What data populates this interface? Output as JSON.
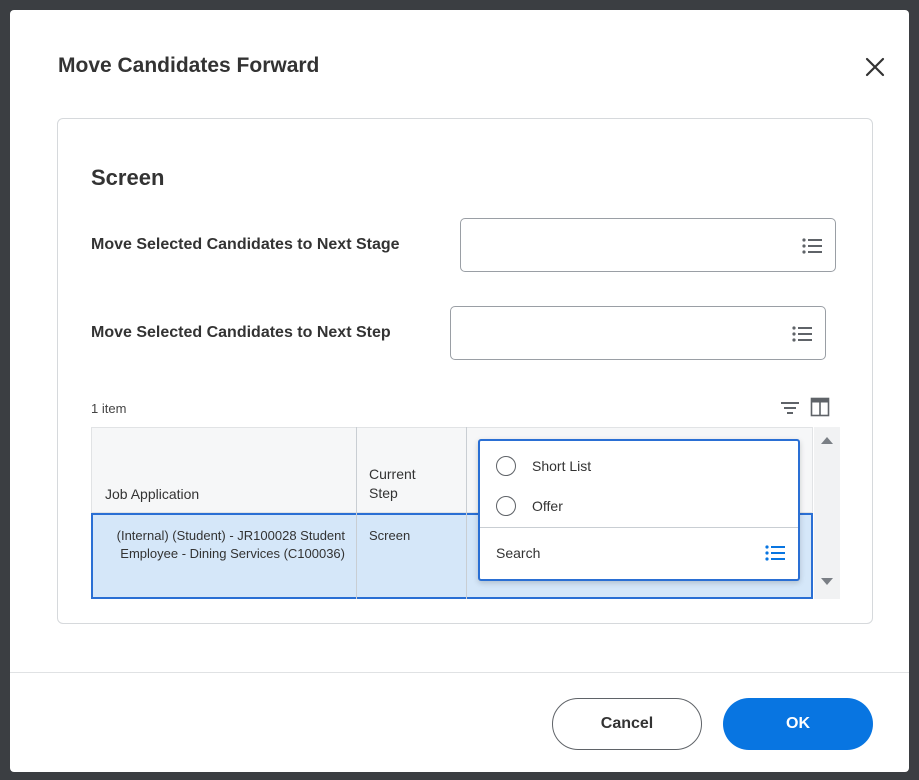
{
  "dialog": {
    "title": "Move Candidates Forward",
    "close_icon": "close-icon"
  },
  "section": {
    "title": "Screen"
  },
  "fields": {
    "next_stage_label": "Move Selected Candidates to Next Stage",
    "next_stage_value": "",
    "next_step_label": "Move Selected Candidates to Next Step",
    "next_step_value": ""
  },
  "grid": {
    "item_count": "1 item",
    "columns": [
      "Job Application",
      "Current Step"
    ],
    "rows": [
      {
        "job_application": "(Internal) (Student) - JR100028 Student Employee - Dining Services (C100036)",
        "current_step": "Screen"
      }
    ]
  },
  "dropdown": {
    "options": [
      "Short List",
      "Offer"
    ],
    "search_placeholder": "Search"
  },
  "footer": {
    "cancel_label": "Cancel",
    "ok_label": "OK"
  },
  "colors": {
    "primary": "#0875e1",
    "selection": "#d5e7f9",
    "focus_border": "#2a6fd4"
  }
}
